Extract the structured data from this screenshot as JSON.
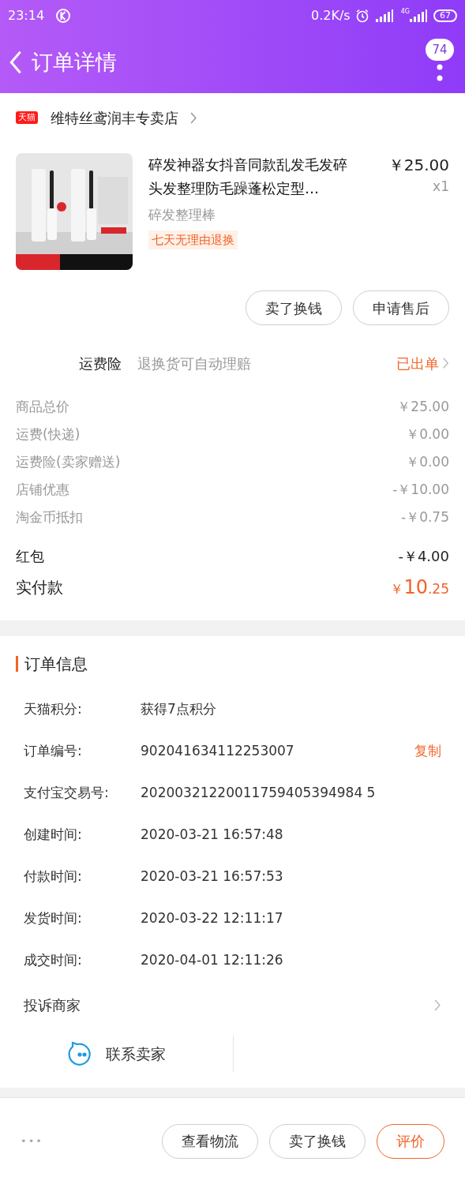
{
  "status_bar": {
    "time": "23:14",
    "speed": "0.2K/s",
    "network": "4G",
    "battery": "67"
  },
  "header": {
    "title": "订单详情",
    "badge": "74"
  },
  "store": {
    "tag": "天猫",
    "name": "维特丝鸢润丰专卖店"
  },
  "product": {
    "kind": "picture",
    "title": "碎发神器女抖音同款乱发毛发碎头发整理防毛躁蓬松定型…",
    "price": "￥25.00",
    "qty": "x1",
    "sku": "碎发整理棒",
    "service_tag": "七天无理由退换"
  },
  "item_actions": [
    "卖了换钱",
    "申请售后"
  ],
  "insurance": {
    "label": "运费险",
    "desc": "退换货可自动理赔",
    "status": "已出单"
  },
  "price_rows": [
    {
      "label": "商品总价",
      "value": "￥25.00"
    },
    {
      "label": "运费(快递)",
      "value": "￥0.00"
    },
    {
      "label": "运费险(卖家赠送)",
      "value": "￥0.00"
    },
    {
      "label": "店铺优惠",
      "value": "-￥10.00"
    },
    {
      "label": "淘金币抵扣",
      "value": "-￥0.75"
    }
  ],
  "red_packet": {
    "label": "红包",
    "value": "-￥4.00"
  },
  "paid": {
    "label": "实付款",
    "currency": "￥",
    "integer": "10",
    "decimal": ".25"
  },
  "order_info": {
    "title": "订单信息",
    "rows": [
      {
        "label": "天猫积分:",
        "value": "获得7点积分"
      },
      {
        "label": "订单编号:",
        "value": "902041634112253007",
        "action": "复制"
      },
      {
        "label": "支付宝交易号:",
        "value": "20200321220011759405394984 5"
      },
      {
        "label": "创建时间:",
        "value": "2020-03-21 16:57:48"
      },
      {
        "label": "付款时间:",
        "value": "2020-03-21 16:57:53"
      },
      {
        "label": "发货时间:",
        "value": "2020-03-22 12:11:17"
      },
      {
        "label": "成交时间:",
        "value": "2020-04-01 12:11:26"
      }
    ],
    "complaint": "投诉商家",
    "contact": "联系卖家"
  },
  "bottom_bar": {
    "more": "•••",
    "buttons": [
      {
        "label": "查看物流",
        "primary": false
      },
      {
        "label": "卖了换钱",
        "primary": false
      },
      {
        "label": "评价",
        "primary": true
      }
    ]
  }
}
